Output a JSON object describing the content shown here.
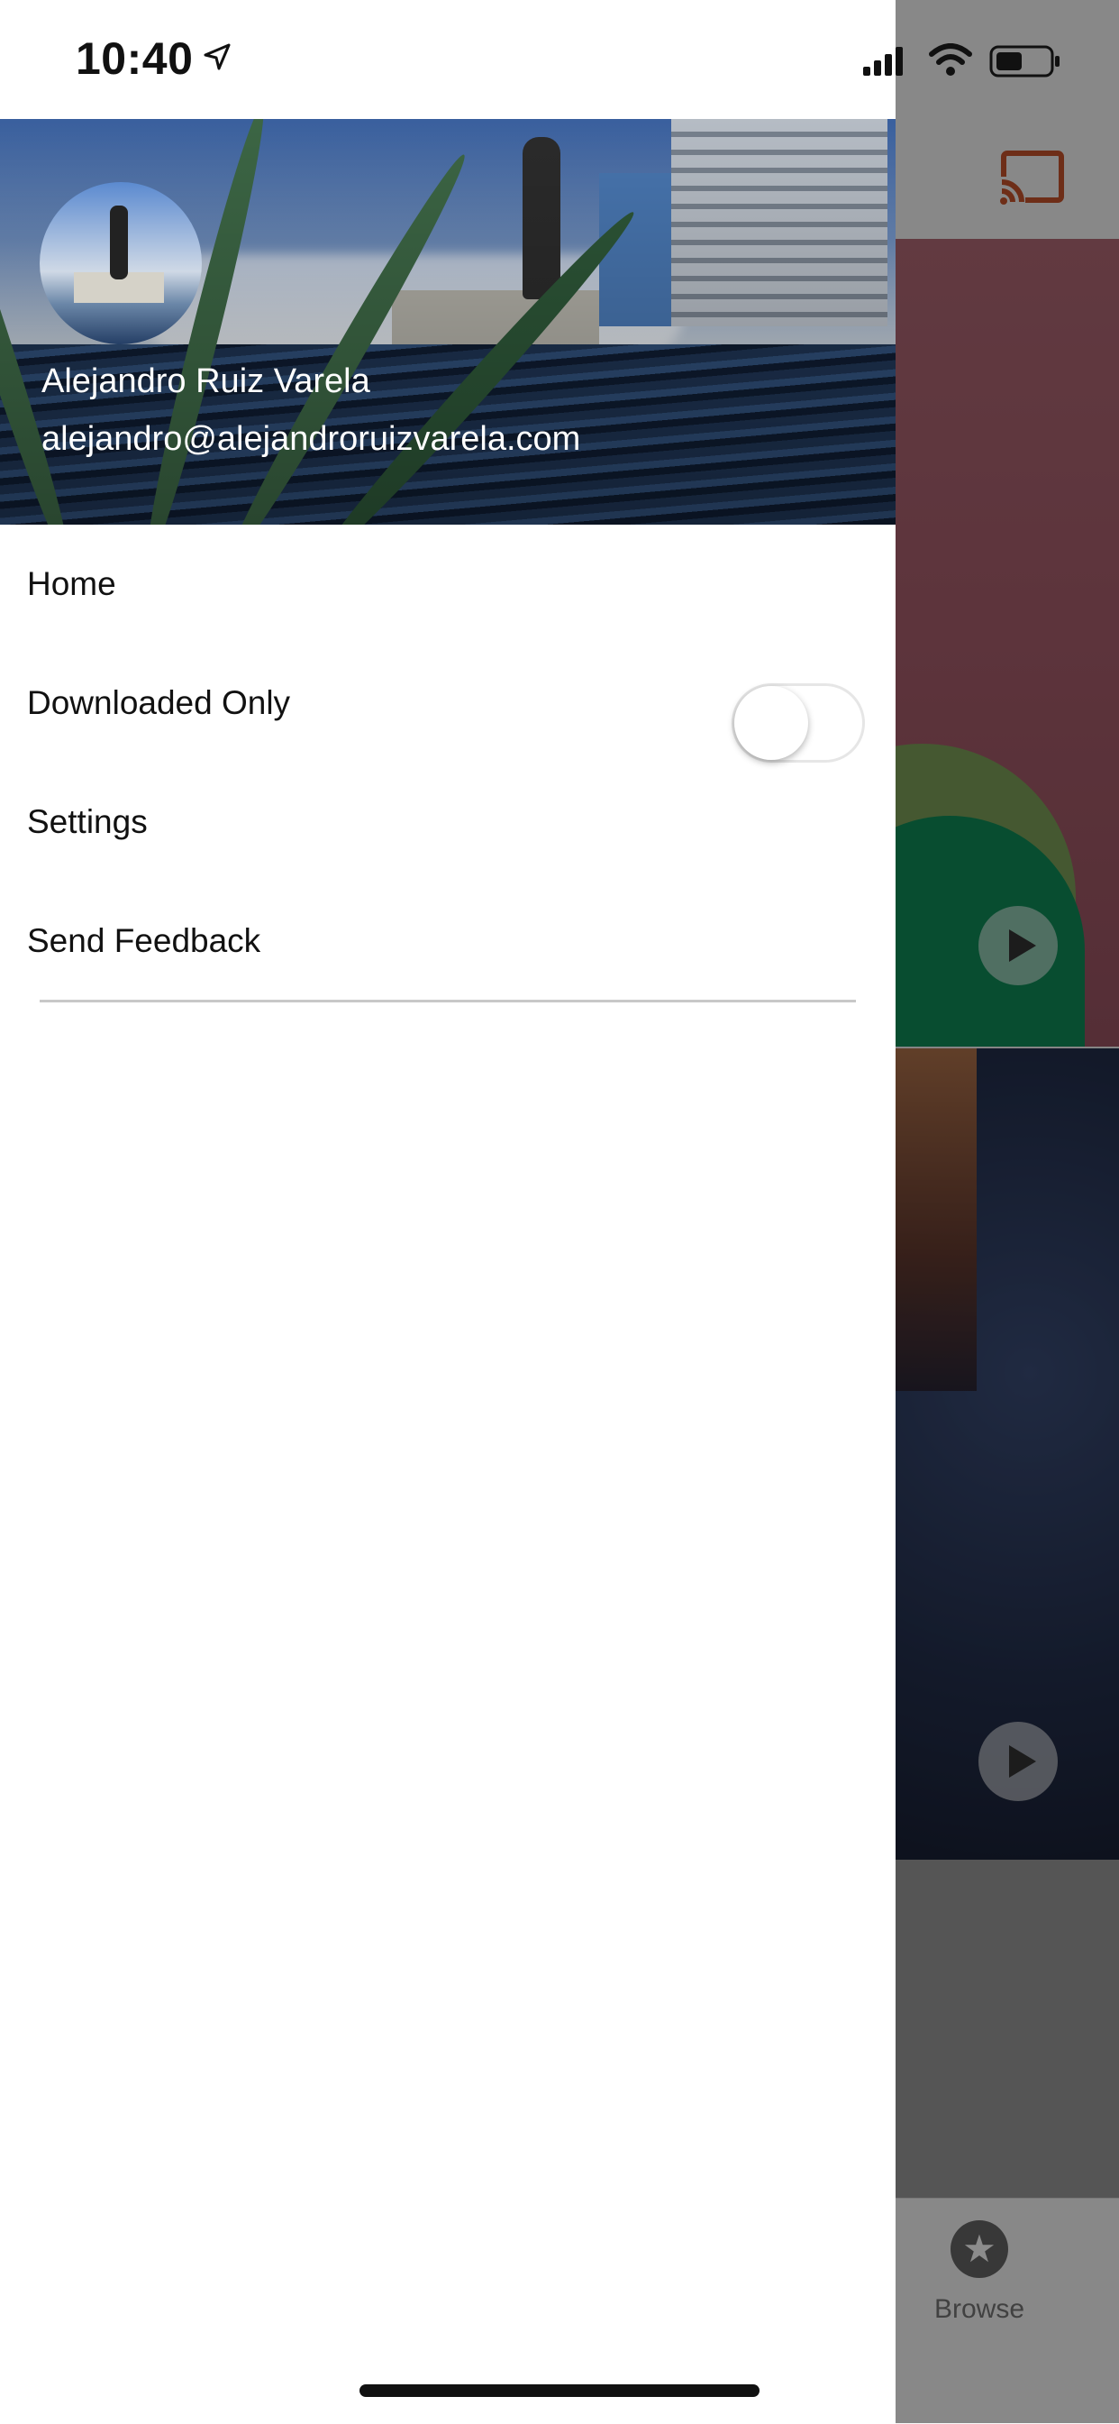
{
  "status_bar": {
    "time": "10:40",
    "icons": [
      "location-arrow-icon",
      "cellular-signal-icon",
      "wifi-icon",
      "battery-icon"
    ]
  },
  "drawer": {
    "user": {
      "name": "Alejandro Ruiz Varela",
      "email": "alejandro@alejandroruizvarela.com"
    },
    "menu": [
      {
        "label": "Home"
      },
      {
        "label": "Downloaded Only",
        "toggle_on": false
      },
      {
        "label": "Settings"
      },
      {
        "label": "Send Feedback"
      }
    ]
  },
  "background_app": {
    "cast_icon": "cast-icon",
    "tab_bar": {
      "browse_label": "Browse",
      "browse_icon": "star-icon"
    }
  },
  "colors": {
    "accent": "#c8552c",
    "dim_overlay": "rgba(0,0,0,0.45)"
  }
}
